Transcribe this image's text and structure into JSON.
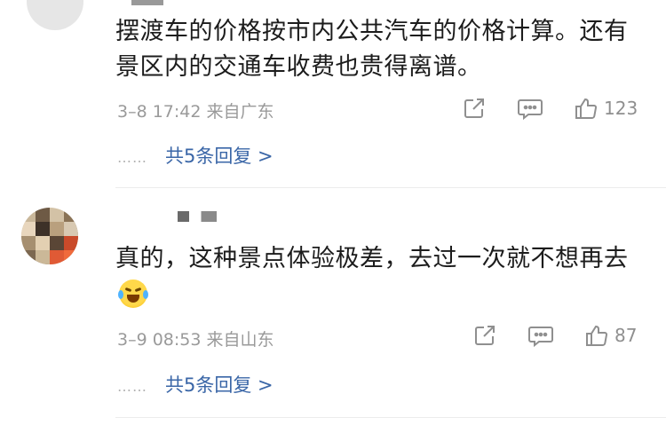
{
  "comments": [
    {
      "text": "摆渡车的价格按市内公共汽车的价格计算。还有景区内的交通车收费也贵得离谱。",
      "meta": "3–8 17:42  来自广东",
      "likes": "123",
      "replies": "共5条回复 >",
      "reply_dots": "……"
    },
    {
      "text": "真的，这种景点体验极差，去过一次就不想再去",
      "meta": "3–9 08:53  来自山东",
      "likes": "87",
      "replies": "共5条回复 >",
      "reply_dots": "……",
      "emoji": "crying-laughing-emoji"
    }
  ],
  "icons": {
    "share": "share-icon",
    "comment": "comment-icon",
    "like": "thumbs-up-icon"
  },
  "colors": {
    "reply_link": "#3a66a7",
    "meta": "#9a9a9a",
    "text": "#1c1c1c"
  }
}
